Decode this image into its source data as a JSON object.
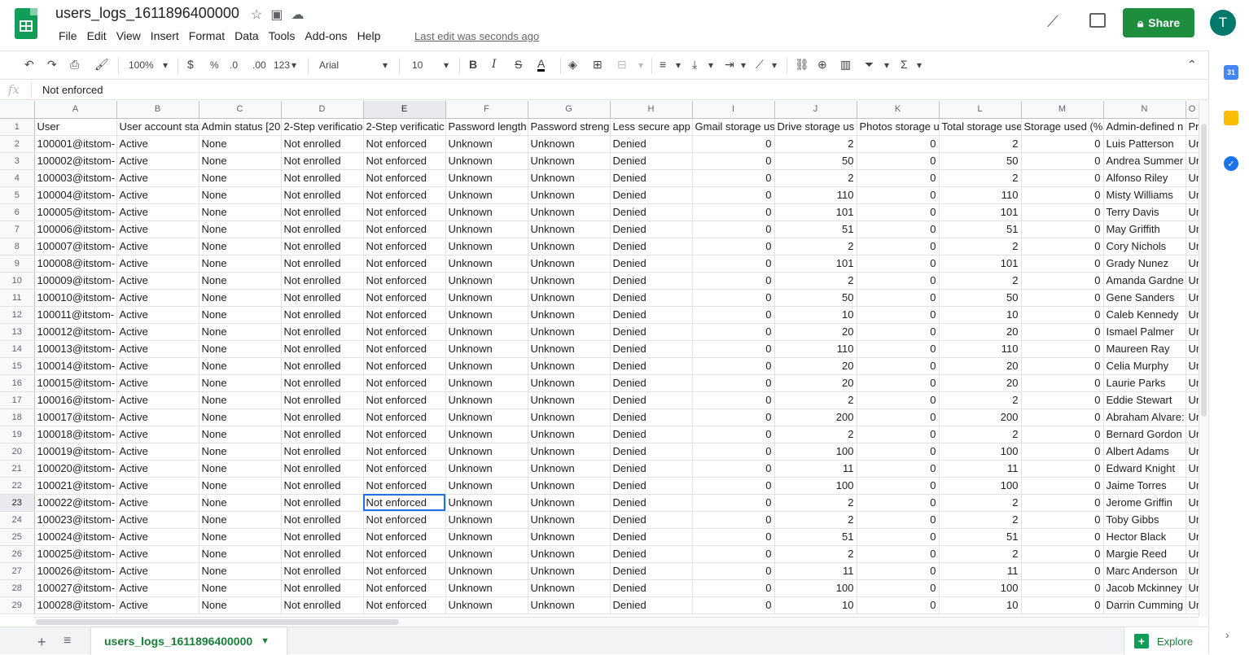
{
  "app": {
    "doc_title": "users_logs_1611896400000",
    "menu": [
      "File",
      "Edit",
      "View",
      "Insert",
      "Format",
      "Data",
      "Tools",
      "Add-ons",
      "Help"
    ],
    "last_edit": "Last edit was seconds ago",
    "share_label": "Share",
    "avatar_initial": "T",
    "brand_color": "#1e8e3e"
  },
  "toolbar": {
    "zoom": "100%",
    "currency": "$",
    "percent": "%",
    "decimal_decrease": ".0",
    "decimal_increase": ".00",
    "more_formats": "123",
    "font": "Arial",
    "font_size": "10",
    "bold": "B",
    "italic": "I",
    "strike": "S",
    "text_color": "A"
  },
  "formula_bar": {
    "fx": "fx",
    "value": "Not enforced"
  },
  "grid": {
    "columns": [
      "A",
      "B",
      "C",
      "D",
      "E",
      "F",
      "G",
      "H",
      "I",
      "J",
      "K",
      "L",
      "M",
      "N",
      "O"
    ],
    "header_row": [
      "User",
      "User account sta",
      "Admin status [20",
      "2-Step verificatio",
      "2-Step verificatic",
      "Password length",
      "Password streng",
      "Less secure app",
      "Gmail storage us",
      "Drive storage us",
      "Photos storage u",
      "Total storage use",
      "Storage used (%",
      "Admin-defined n",
      "Pr"
    ],
    "rows": [
      [
        "100001@itstom-",
        "Active",
        "None",
        "Not enrolled",
        "Not enforced",
        "Unknown",
        "Unknown",
        "Denied",
        "0",
        "2",
        "0",
        "2",
        "0",
        "Luis Patterson",
        "Ur"
      ],
      [
        "100002@itstom-",
        "Active",
        "None",
        "Not enrolled",
        "Not enforced",
        "Unknown",
        "Unknown",
        "Denied",
        "0",
        "50",
        "0",
        "50",
        "0",
        "Andrea Summer",
        "Ur"
      ],
      [
        "100003@itstom-",
        "Active",
        "None",
        "Not enrolled",
        "Not enforced",
        "Unknown",
        "Unknown",
        "Denied",
        "0",
        "2",
        "0",
        "2",
        "0",
        "Alfonso Riley",
        "Ur"
      ],
      [
        "100004@itstom-",
        "Active",
        "None",
        "Not enrolled",
        "Not enforced",
        "Unknown",
        "Unknown",
        "Denied",
        "0",
        "110",
        "0",
        "110",
        "0",
        "Misty Williams",
        "Ur"
      ],
      [
        "100005@itstom-",
        "Active",
        "None",
        "Not enrolled",
        "Not enforced",
        "Unknown",
        "Unknown",
        "Denied",
        "0",
        "101",
        "0",
        "101",
        "0",
        "Terry Davis",
        "Ur"
      ],
      [
        "100006@itstom-",
        "Active",
        "None",
        "Not enrolled",
        "Not enforced",
        "Unknown",
        "Unknown",
        "Denied",
        "0",
        "51",
        "0",
        "51",
        "0",
        "May Griffith",
        "Ur"
      ],
      [
        "100007@itstom-",
        "Active",
        "None",
        "Not enrolled",
        "Not enforced",
        "Unknown",
        "Unknown",
        "Denied",
        "0",
        "2",
        "0",
        "2",
        "0",
        "Cory Nichols",
        "Ur"
      ],
      [
        "100008@itstom-",
        "Active",
        "None",
        "Not enrolled",
        "Not enforced",
        "Unknown",
        "Unknown",
        "Denied",
        "0",
        "101",
        "0",
        "101",
        "0",
        "Grady Nunez",
        "Ur"
      ],
      [
        "100009@itstom-",
        "Active",
        "None",
        "Not enrolled",
        "Not enforced",
        "Unknown",
        "Unknown",
        "Denied",
        "0",
        "2",
        "0",
        "2",
        "0",
        "Amanda Gardne",
        "Ur"
      ],
      [
        "100010@itstom-",
        "Active",
        "None",
        "Not enrolled",
        "Not enforced",
        "Unknown",
        "Unknown",
        "Denied",
        "0",
        "50",
        "0",
        "50",
        "0",
        "Gene Sanders",
        "Ur"
      ],
      [
        "100011@itstom-",
        "Active",
        "None",
        "Not enrolled",
        "Not enforced",
        "Unknown",
        "Unknown",
        "Denied",
        "0",
        "10",
        "0",
        "10",
        "0",
        "Caleb Kennedy",
        "Ur"
      ],
      [
        "100012@itstom-",
        "Active",
        "None",
        "Not enrolled",
        "Not enforced",
        "Unknown",
        "Unknown",
        "Denied",
        "0",
        "20",
        "0",
        "20",
        "0",
        "Ismael Palmer",
        "Ur"
      ],
      [
        "100013@itstom-",
        "Active",
        "None",
        "Not enrolled",
        "Not enforced",
        "Unknown",
        "Unknown",
        "Denied",
        "0",
        "110",
        "0",
        "110",
        "0",
        "Maureen Ray",
        "Ur"
      ],
      [
        "100014@itstom-",
        "Active",
        "None",
        "Not enrolled",
        "Not enforced",
        "Unknown",
        "Unknown",
        "Denied",
        "0",
        "20",
        "0",
        "20",
        "0",
        "Celia Murphy",
        "Ur"
      ],
      [
        "100015@itstom-",
        "Active",
        "None",
        "Not enrolled",
        "Not enforced",
        "Unknown",
        "Unknown",
        "Denied",
        "0",
        "20",
        "0",
        "20",
        "0",
        "Laurie Parks",
        "Ur"
      ],
      [
        "100016@itstom-",
        "Active",
        "None",
        "Not enrolled",
        "Not enforced",
        "Unknown",
        "Unknown",
        "Denied",
        "0",
        "2",
        "0",
        "2",
        "0",
        "Eddie Stewart",
        "Ur"
      ],
      [
        "100017@itstom-",
        "Active",
        "None",
        "Not enrolled",
        "Not enforced",
        "Unknown",
        "Unknown",
        "Denied",
        "0",
        "200",
        "0",
        "200",
        "0",
        "Abraham Alvare:",
        "Ur"
      ],
      [
        "100018@itstom-",
        "Active",
        "None",
        "Not enrolled",
        "Not enforced",
        "Unknown",
        "Unknown",
        "Denied",
        "0",
        "2",
        "0",
        "2",
        "0",
        "Bernard Gordon",
        "Ur"
      ],
      [
        "100019@itstom-",
        "Active",
        "None",
        "Not enrolled",
        "Not enforced",
        "Unknown",
        "Unknown",
        "Denied",
        "0",
        "100",
        "0",
        "100",
        "0",
        "Albert Adams",
        "Ur"
      ],
      [
        "100020@itstom-",
        "Active",
        "None",
        "Not enrolled",
        "Not enforced",
        "Unknown",
        "Unknown",
        "Denied",
        "0",
        "11",
        "0",
        "11",
        "0",
        "Edward Knight",
        "Ur"
      ],
      [
        "100021@itstom-",
        "Active",
        "None",
        "Not enrolled",
        "Not enforced",
        "Unknown",
        "Unknown",
        "Denied",
        "0",
        "100",
        "0",
        "100",
        "0",
        "Jaime Torres",
        "Ur"
      ],
      [
        "100022@itstom-",
        "Active",
        "None",
        "Not enrolled",
        "Not enforced",
        "Unknown",
        "Unknown",
        "Denied",
        "0",
        "2",
        "0",
        "2",
        "0",
        "Jerome Griffin",
        "Ur"
      ],
      [
        "100023@itstom-",
        "Active",
        "None",
        "Not enrolled",
        "Not enforced",
        "Unknown",
        "Unknown",
        "Denied",
        "0",
        "2",
        "0",
        "2",
        "0",
        "Toby Gibbs",
        "Ur"
      ],
      [
        "100024@itstom-",
        "Active",
        "None",
        "Not enrolled",
        "Not enforced",
        "Unknown",
        "Unknown",
        "Denied",
        "0",
        "51",
        "0",
        "51",
        "0",
        "Hector Black",
        "Ur"
      ],
      [
        "100025@itstom-",
        "Active",
        "None",
        "Not enrolled",
        "Not enforced",
        "Unknown",
        "Unknown",
        "Denied",
        "0",
        "2",
        "0",
        "2",
        "0",
        "Margie Reed",
        "Ur"
      ],
      [
        "100026@itstom-",
        "Active",
        "None",
        "Not enrolled",
        "Not enforced",
        "Unknown",
        "Unknown",
        "Denied",
        "0",
        "11",
        "0",
        "11",
        "0",
        "Marc Anderson",
        "Ur"
      ],
      [
        "100027@itstom-",
        "Active",
        "None",
        "Not enrolled",
        "Not enforced",
        "Unknown",
        "Unknown",
        "Denied",
        "0",
        "100",
        "0",
        "100",
        "0",
        "Jacob Mckinney",
        "Ur"
      ],
      [
        "100028@itstom-",
        "Active",
        "None",
        "Not enrolled",
        "Not enforced",
        "Unknown",
        "Unknown",
        "Denied",
        "0",
        "10",
        "0",
        "10",
        "0",
        "Darrin Cumming",
        "Ur"
      ]
    ]
  },
  "sheet_tabs": {
    "active": "users_logs_1611896400000",
    "explore_label": "Explore"
  },
  "side_panel": {
    "calendar_label": "31"
  }
}
